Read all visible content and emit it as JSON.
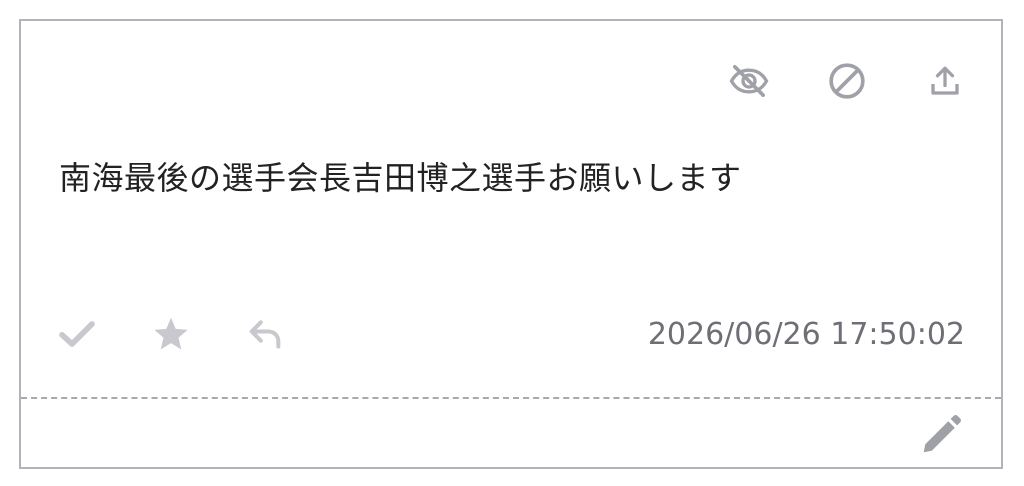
{
  "message": {
    "text": "南海最後の選手会長吉田博之選手お願いします",
    "timestamp": "2026/06/26 17:50:02"
  },
  "top_actions": {
    "hide": {
      "icon": "eye-off-icon"
    },
    "block": {
      "icon": "block-icon"
    },
    "share": {
      "icon": "upload-icon"
    }
  },
  "bottom_actions": {
    "check": {
      "icon": "check-icon"
    },
    "star": {
      "icon": "star-icon"
    },
    "reply": {
      "icon": "reply-icon"
    }
  },
  "footer": {
    "edit": {
      "icon": "pencil-icon"
    }
  },
  "colors": {
    "icon": "#a0a0a8",
    "icon_light": "#c8c8ce",
    "text": "#222222",
    "timestamp": "#6e6e76",
    "border": "#b3b3bc"
  }
}
